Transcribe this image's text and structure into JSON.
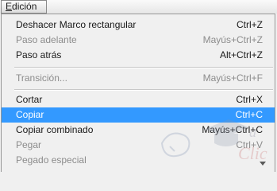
{
  "menubar": {
    "title": "Edición",
    "title_mnemonic": "E",
    "title_rest": "dición"
  },
  "menu": {
    "items": [
      {
        "label": "Deshacer Marco rectangular",
        "shortcut": "Ctrl+Z",
        "state": "enabled"
      },
      {
        "label": "Paso adelante",
        "shortcut": "Mayús+Ctrl+Z",
        "state": "disabled"
      },
      {
        "label": "Paso atrás",
        "shortcut": "Alt+Ctrl+Z",
        "state": "enabled"
      },
      {
        "label": "Transición...",
        "shortcut": "Mayús+Ctrl+F",
        "state": "disabled"
      },
      {
        "label": "Cortar",
        "shortcut": "Ctrl+X",
        "state": "enabled"
      },
      {
        "label": "Copiar",
        "shortcut": "Ctrl+C",
        "state": "highlighted"
      },
      {
        "label": "Copiar combinado",
        "shortcut": "Mayús+Ctrl+C",
        "state": "enabled"
      },
      {
        "label": "Pegar",
        "shortcut": "Ctrl+V",
        "state": "disabled"
      },
      {
        "label": "Pegado especial",
        "shortcut": "",
        "state": "disabled"
      }
    ]
  },
  "watermark": {
    "text": "aulaClic"
  },
  "colors": {
    "highlight": "#3399ff",
    "disabled_text": "#8c8c8c",
    "menu_background": "#f0f0f0"
  }
}
